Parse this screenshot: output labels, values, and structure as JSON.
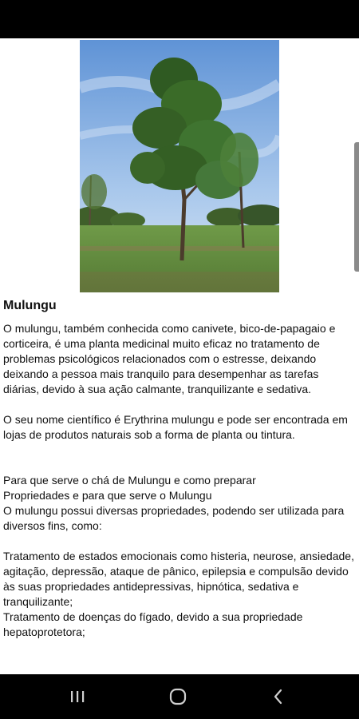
{
  "article": {
    "title": "Mulungu",
    "image_alt": "Árvore de mulungu em um campo gramado",
    "paragraphs": [
      "O mulungu, também conhecida como canivete, bico-de-papagaio e corticeira, é uma planta medicinal muito eficaz no tratamento de problemas psicológicos relacionados com o estresse, deixando deixando a pessoa mais tranquilo para desempenhar as tarefas diárias, devido à sua ação calmante, tranquilizante e sedativa.",
      "O seu nome científico é Erythrina mulungu e pode ser encontrada em lojas de produtos naturais sob a forma de planta ou tintura.",
      "Para que serve o chá de Mulungu e como preparar",
      "Propriedades e para que serve o Mulungu",
      "O mulungu possui diversas propriedades, podendo ser utilizada para diversos fins, como:",
      "Tratamento de estados emocionais como histeria, neurose, ansiedade, agitação, depressão, ataque de pânico, epilepsia e compulsão devido às suas propriedades antidepressivas, hipnótica, sedativa e tranquilizante;",
      "Tratamento de doenças do fígado, devido a sua propriedade hepatoprotetora;"
    ]
  },
  "navigation": {
    "recent_icon": "recent-apps-icon",
    "home_icon": "home-icon",
    "back_icon": "back-icon"
  }
}
